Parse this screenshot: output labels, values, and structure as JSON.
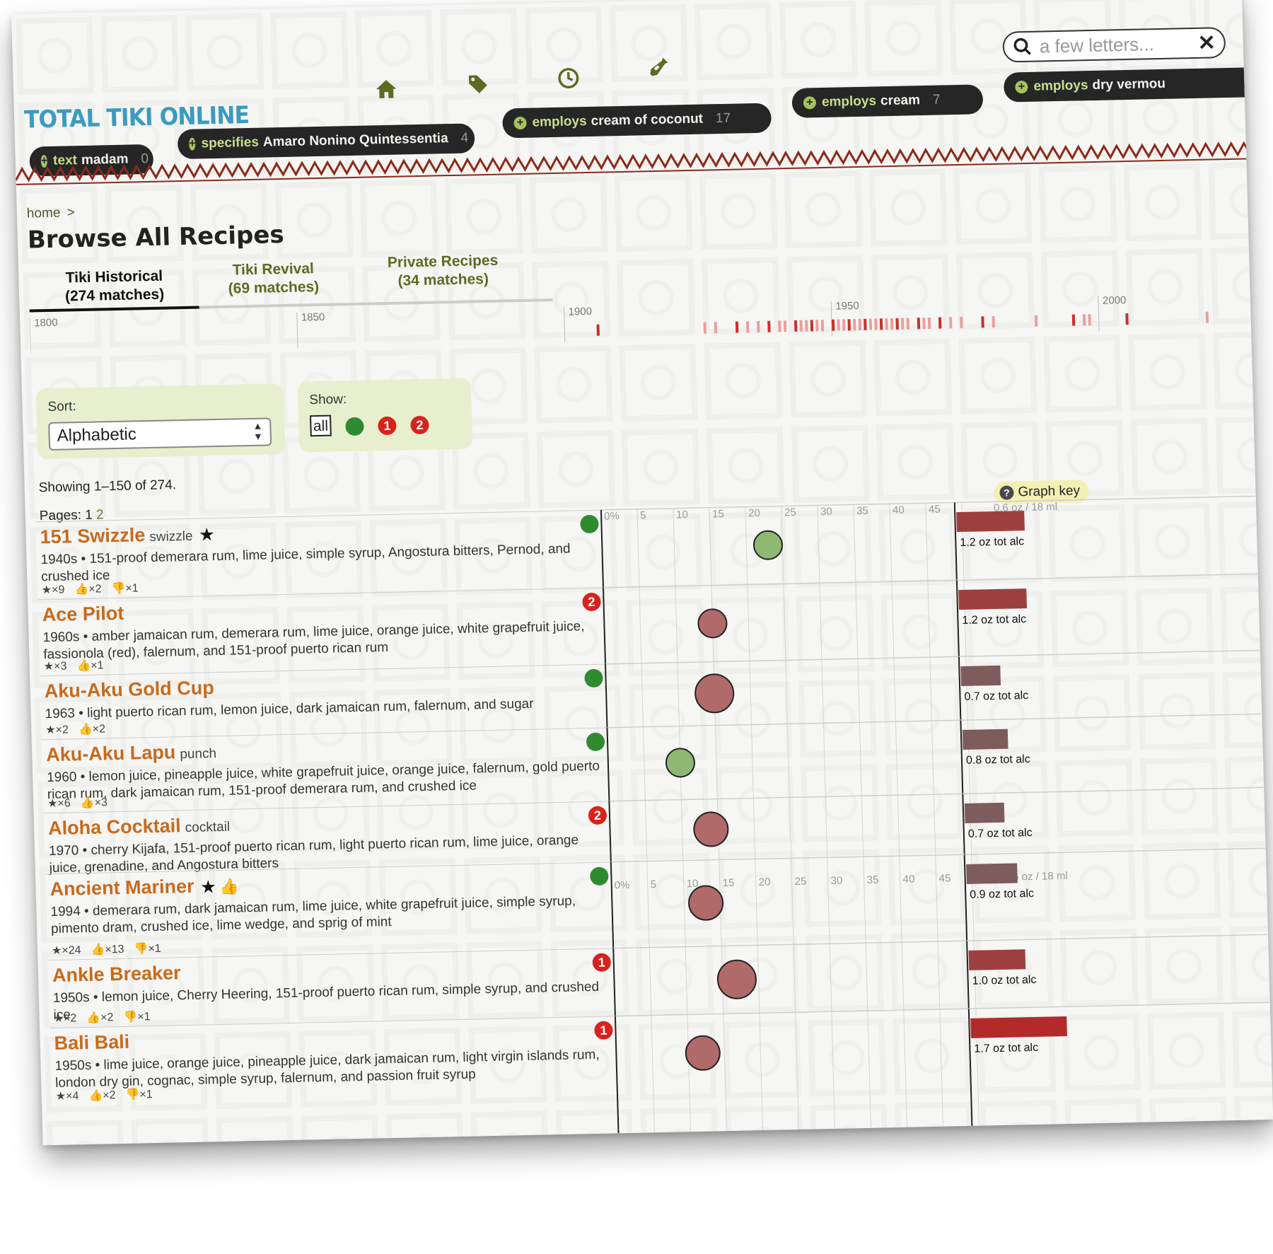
{
  "logo": "TOTAL TIKI ONLINE",
  "nav_icons": [
    "home-icon",
    "tag-icon",
    "clock-icon",
    "bottle-icon"
  ],
  "search": {
    "placeholder": "a few letters..."
  },
  "filters": [
    {
      "prefix": "text",
      "term": "madam",
      "count": "0"
    },
    {
      "prefix": "specifies",
      "term": "Amaro Nonino Quintessentia",
      "count": "4"
    },
    {
      "prefix": "employs",
      "term": "cream of coconut",
      "count": "17"
    },
    {
      "prefix": "employs",
      "term": "cream",
      "count": "7"
    },
    {
      "prefix": "employs",
      "term": "dry vermou",
      "count": ""
    }
  ],
  "breadcrumb": {
    "home": "home",
    "sep": ">"
  },
  "title": "Browse All Recipes",
  "tabs": [
    {
      "label": "Tiki Historical",
      "matches": "(274 matches)",
      "active": true
    },
    {
      "label": "Tiki Revival",
      "matches": "(69 matches)",
      "active": false
    },
    {
      "label": "Private Recipes",
      "matches": "(34 matches)",
      "active": false
    }
  ],
  "timeline": {
    "labels": [
      "1800",
      "1850",
      "1900",
      "1950",
      "2000"
    ],
    "ticks": [
      1906,
      1926,
      1928,
      1932,
      1934,
      1936,
      1938,
      1940,
      1941,
      1943,
      1944,
      1945,
      1946,
      1947,
      1948,
      1950,
      1951,
      1952,
      1953,
      1954,
      1955,
      1956,
      1957,
      1958,
      1959,
      1960,
      1961,
      1962,
      1963,
      1964,
      1966,
      1967,
      1968,
      1970,
      1972,
      1974,
      1978,
      1980,
      1988,
      1995,
      1997,
      1998,
      2005,
      2020
    ]
  },
  "sort": {
    "label": "Sort:",
    "value": "Alphabetic"
  },
  "show": {
    "label": "Show:",
    "all": "all",
    "one": "1",
    "two": "2"
  },
  "showing": "Showing 1–150 of 274.",
  "pages": {
    "label": "Pages:",
    "p1": "1",
    "p2": "2"
  },
  "graph_key": "Graph key",
  "graph": {
    "pct_ticks": [
      "0%",
      "5",
      "10",
      "15",
      "20",
      "25",
      "30",
      "35",
      "40",
      "45"
    ],
    "oz_label": "0.6 oz / 18 ml"
  },
  "recipes": [
    {
      "name": "151 Swizzle",
      "type": "swizzle",
      "badges": "★",
      "desc": "1940s • 151-proof demerara rum, lime juice, simple syrup, Angostura bitters, Pernod, and crushed ice",
      "stats": [
        "★×9",
        "👍×2",
        "👎×1"
      ],
      "status": "green",
      "abv": 23,
      "size": "small",
      "alc": 1.2,
      "alc_label": "1.2 oz tot alc"
    },
    {
      "name": "Ace Pilot",
      "type": "",
      "badges": "",
      "desc": "1960s • amber jamaican rum, demerara rum, lime juice, orange juice, white grapefruit juice, fassionola (red), falernum, and 151-proof puerto rican rum",
      "stats": [
        "★×3",
        "👍×1"
      ],
      "status": "2",
      "abv": 15,
      "size": "small",
      "alc": 1.2,
      "alc_label": "1.2 oz tot alc"
    },
    {
      "name": "Aku-Aku Gold Cup",
      "type": "",
      "badges": "",
      "desc": "1963 • light puerto rican rum, lemon juice, dark jamaican rum, falernum, and sugar",
      "stats": [
        "★×2",
        "👍×2"
      ],
      "status": "green",
      "abv": 15,
      "size": "large",
      "alc": 0.7,
      "alc_label": "0.7 oz tot alc"
    },
    {
      "name": "Aku-Aku Lapu",
      "type": "punch",
      "badges": "",
      "desc": "1960 • lemon juice, pineapple juice, white grapefruit juice, orange juice, falernum, gold puerto rican rum, dark jamaican rum, 151-proof demerara rum, and crushed ice",
      "stats": [
        "★×6",
        "👍×3"
      ],
      "status": "green",
      "abv": 10,
      "size": "small",
      "alc": 0.8,
      "alc_label": "0.8 oz tot alc"
    },
    {
      "name": "Aloha Cocktail",
      "type": "cocktail",
      "badges": "",
      "desc": "1970 • cherry Kijafa, 151-proof puerto rican rum, light puerto rican rum, lime juice, orange juice, grenadine, and Angostura bitters",
      "stats": [],
      "status": "2",
      "abv": 14,
      "size": "medium",
      "alc": 0.7,
      "alc_label": "0.7 oz tot alc"
    },
    {
      "name": "Ancient Mariner",
      "type": "",
      "badges": "★ 👍",
      "desc": "1994 • demerara rum, dark jamaican rum, lime juice, white grapefruit juice, simple syrup, pimento dram, crushed ice, lime wedge, and sprig of mint",
      "stats": [
        "★×24",
        "👍×13",
        "👎×1"
      ],
      "status": "green",
      "abv": 13,
      "size": "medium",
      "alc": 0.9,
      "alc_label": "0.9 oz tot alc"
    },
    {
      "name": "Ankle Breaker",
      "type": "",
      "badges": "",
      "desc": "1950s • lemon juice, Cherry Heering, 151-proof puerto rican rum, simple syrup, and crushed ice",
      "stats": [
        "★×2",
        "👍×2",
        "👎×1"
      ],
      "status": "1",
      "abv": 17,
      "size": "large",
      "alc": 1.0,
      "alc_label": "1.0 oz tot alc"
    },
    {
      "name": "Bali Bali",
      "type": "",
      "badges": "",
      "desc": "1950s • lime juice, orange juice, pineapple juice, dark jamaican rum, light virgin islands rum, london dry gin, cognac, simple syrup, falernum, and passion fruit syrup",
      "stats": [
        "★×4",
        "👍×2",
        "👎×1"
      ],
      "status": "1",
      "abv": 12,
      "size": "medium",
      "alc": 1.7,
      "alc_label": "1.7 oz tot alc"
    }
  ],
  "colors": {
    "accent_orange": "#c86a1c",
    "green": "#2e8b2e",
    "red": "#d8231c",
    "logo": "#3b9bc0",
    "pill_bg": "#262626"
  }
}
